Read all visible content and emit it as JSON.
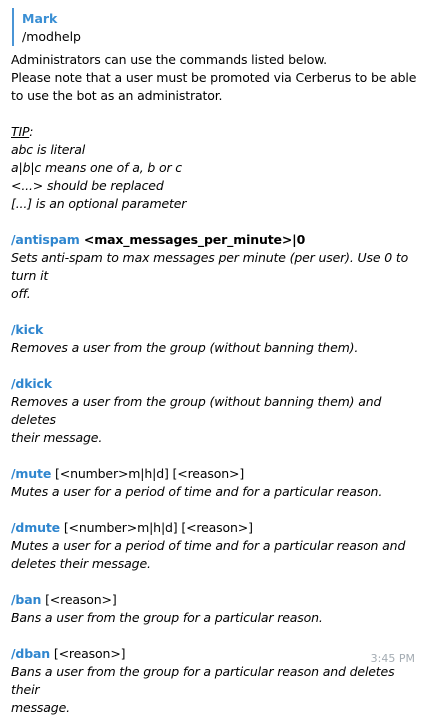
{
  "reply": {
    "author": "Mark",
    "text": "/modhelp"
  },
  "intro": {
    "line1": "Administrators can use the commands listed below.",
    "line2": "Please note that a user must be promoted via Cerberus to be able",
    "line3": "to use the bot as an administrator."
  },
  "tip": {
    "label": "TIP",
    "colon": ":",
    "lines": [
      "abc is literal",
      "a|b|c means one of a, b or c",
      "<...> should be replaced",
      "[...] is an optional parameter"
    ]
  },
  "commands": [
    {
      "name": "/antispam",
      "args": " <max_messages_per_minute>|0",
      "args_bold": true,
      "desc_lines": [
        "Sets anti-spam to max messages per minute (per user). Use 0 to turn it",
        "off."
      ]
    },
    {
      "name": "/kick",
      "args": "",
      "args_bold": false,
      "desc_lines": [
        "Removes a user from the group (without banning them)."
      ]
    },
    {
      "name": "/dkick",
      "args": "",
      "args_bold": false,
      "desc_lines": [
        "Removes a user from the group (without banning them) and deletes",
        "their message."
      ]
    },
    {
      "name": "/mute",
      "args": " [<number>m|h|d] [<reason>]",
      "args_bold": false,
      "desc_lines": [
        "Mutes a user for a period of time and for a particular reason."
      ]
    },
    {
      "name": "/dmute",
      "args": " [<number>m|h|d] [<reason>]",
      "args_bold": false,
      "desc_lines": [
        "Mutes a user for a period of time and for a particular reason and",
        "deletes their message."
      ]
    },
    {
      "name": "/ban",
      "args": " [<reason>]",
      "args_bold": false,
      "desc_lines": [
        "Bans a user from the group for a particular reason."
      ]
    },
    {
      "name": "/dban",
      "args": " [<reason>]",
      "args_bold": false,
      "desc_lines": [
        "Bans a user from the group for a particular reason and deletes their",
        "message."
      ]
    }
  ],
  "timestamp": "3:45 PM",
  "colors": {
    "command": "#2f86cf",
    "reply_bar": "#4a95d6",
    "timestamp": "#a4acb3"
  }
}
